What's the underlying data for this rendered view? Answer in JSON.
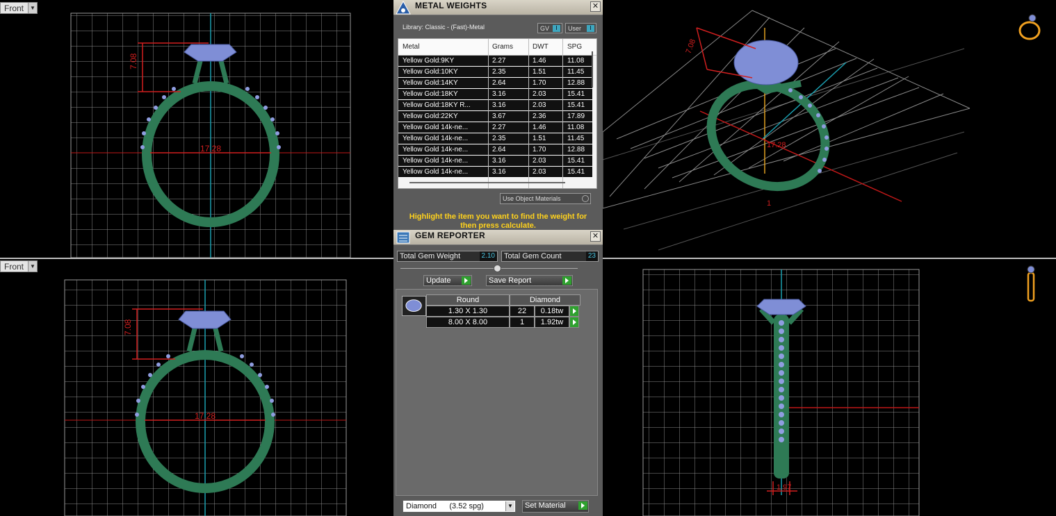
{
  "viewports": {
    "top_left_label": "Front",
    "bottom_left_label": "Front",
    "dims": {
      "tl_height": "7.08",
      "tl_width": "17.28",
      "bl_height": "7.08",
      "bl_width": "17.28",
      "tr_width": "17.28",
      "tr_height": "7.08",
      "tr_small": "1",
      "br_width": "1.97"
    }
  },
  "metal_weights": {
    "title": "METAL WEIGHTS",
    "library": "Library: Classic - (Fast)-Metal",
    "gv_label": "GV",
    "user_label": "User",
    "columns": [
      "Metal",
      "Grams",
      "DWT",
      "SPG"
    ],
    "rows": [
      {
        "metal": "Yellow Gold:9KY",
        "grams": "2.27",
        "dwt": "1.46",
        "spg": "11.08"
      },
      {
        "metal": "Yellow Gold:10KY",
        "grams": "2.35",
        "dwt": "1.51",
        "spg": "11.45"
      },
      {
        "metal": "Yellow Gold:14KY",
        "grams": "2.64",
        "dwt": "1.70",
        "spg": "12.88"
      },
      {
        "metal": "Yellow Gold:18KY",
        "grams": "3.16",
        "dwt": "2.03",
        "spg": "15.41"
      },
      {
        "metal": "Yellow Gold:18KY R...",
        "grams": "3.16",
        "dwt": "2.03",
        "spg": "15.41"
      },
      {
        "metal": "Yellow Gold:22KY",
        "grams": "3.67",
        "dwt": "2.36",
        "spg": "17.89"
      },
      {
        "metal": "Yellow Gold 14k-ne...",
        "grams": "2.27",
        "dwt": "1.46",
        "spg": "11.08"
      },
      {
        "metal": "Yellow Gold 14k-ne...",
        "grams": "2.35",
        "dwt": "1.51",
        "spg": "11.45"
      },
      {
        "metal": "Yellow Gold 14k-ne...",
        "grams": "2.64",
        "dwt": "1.70",
        "spg": "12.88"
      },
      {
        "metal": "Yellow Gold 14k-ne...",
        "grams": "3.16",
        "dwt": "2.03",
        "spg": "15.41"
      },
      {
        "metal": "Yellow Gold 14k-ne...",
        "grams": "3.16",
        "dwt": "2.03",
        "spg": "15.41"
      }
    ],
    "use_object_materials": "Use Object Materials",
    "hint": "Highlight the item you want to find the weight for then press calculate."
  },
  "gem_reporter": {
    "title": "GEM REPORTER",
    "total_weight_label": "Total Gem Weight",
    "total_weight_value": "2.10",
    "total_count_label": "Total Gem Count",
    "total_count_value": "23",
    "update_label": "Update",
    "save_report_label": "Save Report",
    "shape": "Round",
    "material": "Diamond",
    "rows": [
      {
        "size": "1.30 X 1.30",
        "count": "22",
        "weight": "0.18tw"
      },
      {
        "size": "8.00 X 8.00",
        "count": "1",
        "weight": "1.92tw"
      }
    ],
    "material_select": "Diamond      (3.52 spg)",
    "set_material_label": "Set Material"
  },
  "colors": {
    "ring_green": "#2e7a55",
    "gem_blue": "#7f8ed6",
    "dim_red": "#d21f1f",
    "axis_cyan": "#1a9fb0",
    "hint_yellow": "#ffd21c"
  }
}
